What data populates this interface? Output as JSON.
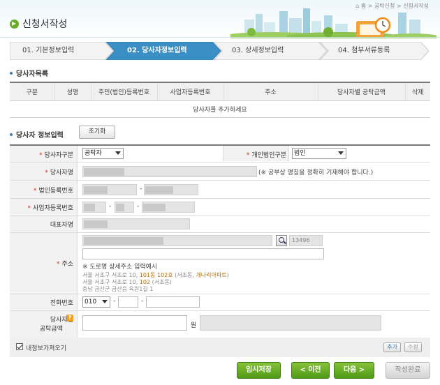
{
  "header": {
    "breadcrumb": {
      "home": "홈",
      "sep1": ">",
      "crumb1": "공탁신청",
      "sep2": ">",
      "crumb2": "신청서작성"
    },
    "title": "신청서작성"
  },
  "steps": [
    {
      "label": "01. 기본정보입력",
      "active": false
    },
    {
      "label": "02. 당사자정보입력",
      "active": true
    },
    {
      "label": "03. 상세정보입력",
      "active": false
    },
    {
      "label": "04. 첨부서류등록",
      "active": false
    }
  ],
  "party_list": {
    "title": "당사자목록",
    "columns": [
      "구분",
      "성명",
      "주민(법인)등록번호",
      "사업자등록번호",
      "주소",
      "당사자별 공탁금액",
      "삭제"
    ],
    "empty_message": "당사자를 추가하세요"
  },
  "party_input": {
    "title": "당사자 정보입력",
    "reset_label": "초기화",
    "party_type": {
      "label": "당사자구분",
      "value": "공탁자"
    },
    "entity_type": {
      "label": "개인법인구분",
      "value": "법인"
    },
    "name": {
      "label": "당사자명",
      "note": "(※ 공부상 명칭을 정확히 기재해야 합니다.)"
    },
    "corp_reg_no": {
      "label": "법인등록번호",
      "dash": "-"
    },
    "biz_reg_no": {
      "label": "사업자등록번호",
      "dash1": "-",
      "dash2": "-"
    },
    "representative": {
      "label": "대표자명"
    },
    "address": {
      "label": "주소",
      "zip": "13496",
      "example_title": "※ 도로명 상세주소 입력예시",
      "examples": [
        {
          "pre": "서울 서초구 서초로 10, ",
          "hl": "101동 102호",
          "mid": " (서초동, ",
          "hl2": "개나리아파트",
          "post": ")"
        },
        {
          "pre": "서울 서초구 서초로 10, ",
          "hl": "102",
          "mid": " (서초동)",
          "hl2": "",
          "post": ""
        },
        {
          "pre": "충남 금산군 금산읍 육원1길 1",
          "hl": "",
          "mid": "",
          "hl2": "",
          "post": ""
        }
      ]
    },
    "phone": {
      "label": "전화번호",
      "area": "010",
      "dash1": "-",
      "dash2": "-"
    },
    "amount": {
      "label1": "당사자별",
      "label2": "공탁금액",
      "unit": "원",
      "help_icon": "?"
    },
    "load_mine": {
      "label": "내정보가져오기",
      "checked": true
    },
    "add_label": "추가",
    "edit_label": "수정"
  },
  "actions": {
    "temp_save": "임시저장",
    "prev": "< 이전",
    "next": "다음 >",
    "complete": "작성완료"
  },
  "colors": {
    "accent_green": "#4f9a16",
    "required_red": "#d9301e",
    "step_active": "#3a8fc4"
  }
}
